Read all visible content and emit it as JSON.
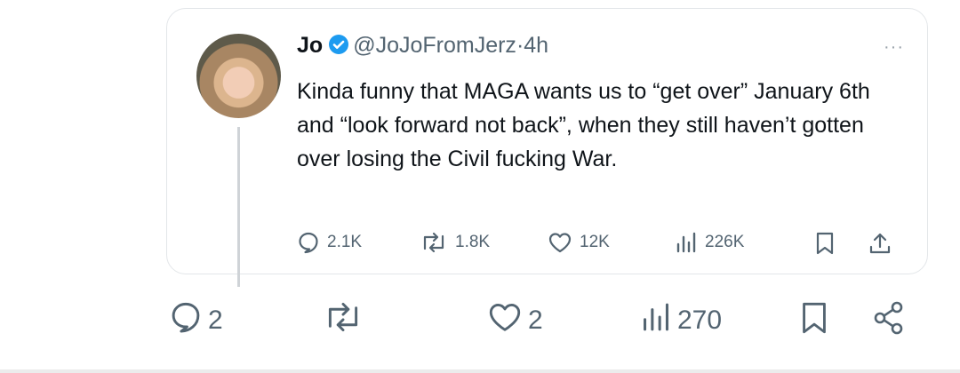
{
  "quoted_tweet": {
    "author_name": "Jo",
    "handle": "@JoJoFromJerz",
    "separator": "·",
    "time": "4h",
    "more_label": "···",
    "text": "Kinda funny that MAGA wants us to “get over” January 6th and “look forward not back”, when they still haven’t gotten over losing the Civil fucking War.",
    "stats": {
      "replies": "2.1K",
      "reposts": "1.8K",
      "likes": "12K",
      "views": "226K"
    },
    "colors": {
      "verified": "#1d9bf0",
      "text": "#0f1419",
      "muted": "#536471"
    }
  },
  "post_actions": {
    "replies": "2",
    "likes": "2",
    "views": "270"
  },
  "icons": [
    "reply-icon",
    "repost-icon",
    "like-icon",
    "views-icon",
    "bookmark-icon",
    "share-icon",
    "verified-badge-icon"
  ]
}
